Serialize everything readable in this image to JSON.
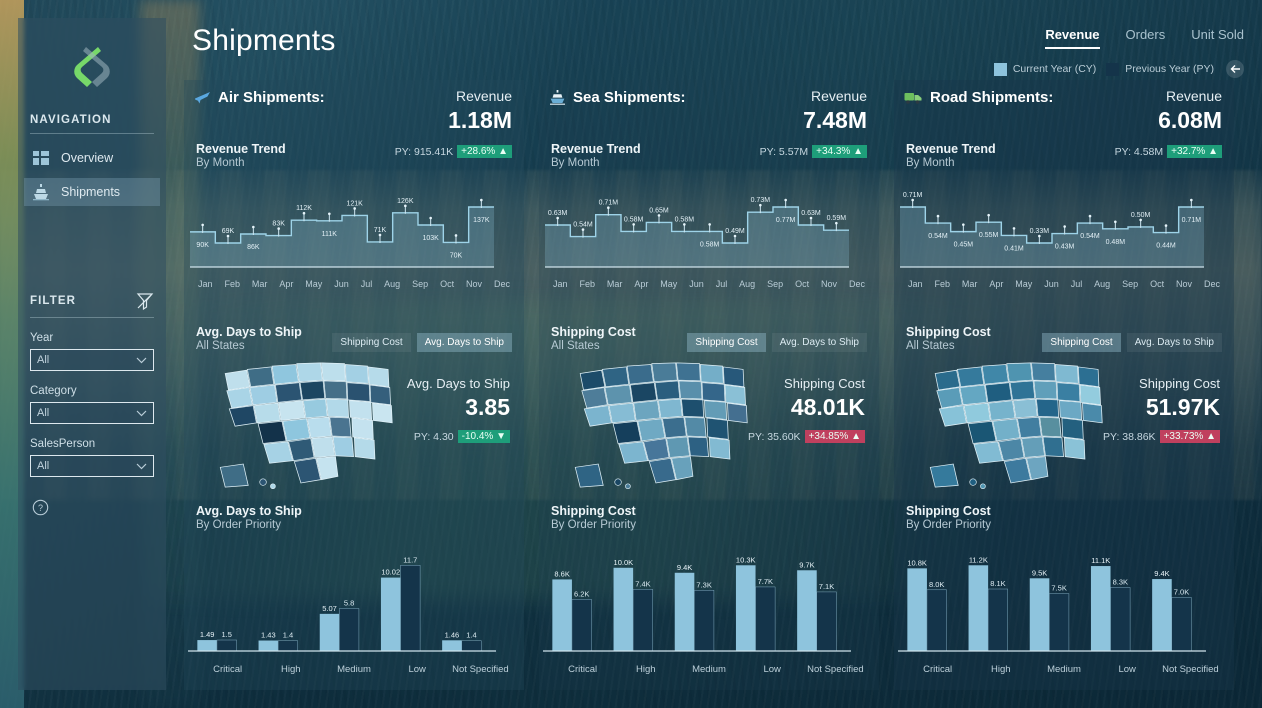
{
  "app": {
    "page_title": "Shipments",
    "logo": "s-logo-icon"
  },
  "sidebar": {
    "nav_heading": "NAVIGATION",
    "items": [
      {
        "label": "Overview",
        "icon": "dashboard-icon",
        "active": false
      },
      {
        "label": "Shipments",
        "icon": "ship-icon",
        "active": true
      }
    ],
    "filter_heading": "FILTER",
    "filter_icon": "clear-filter-icon",
    "filters": [
      {
        "label": "Year",
        "value": "All"
      },
      {
        "label": "Category",
        "value": "All"
      },
      {
        "label": "SalesPerson",
        "value": "All"
      }
    ],
    "help_icon": "question-circle-icon"
  },
  "header": {
    "tabs": [
      {
        "label": "Revenue",
        "active": true
      },
      {
        "label": "Orders",
        "active": false
      },
      {
        "label": "Unit Sold",
        "active": false
      }
    ],
    "legend": [
      {
        "label": "Current Year (CY)",
        "color": "#8ec4dd"
      },
      {
        "label": "Previous Year (PY)",
        "color": "#14344a"
      }
    ],
    "back_icon": "arrow-left-icon"
  },
  "colors": {
    "cy": "#8ec4dd",
    "py": "#14344a",
    "good": "#1e9e7a",
    "bad": "#c0405e",
    "accent_line": "#9ed3e8"
  },
  "cards": [
    {
      "id": "air",
      "icon": "airplane-icon",
      "title": "Air Shipments:",
      "kpi_label": "Revenue",
      "kpi_value": "1.18M",
      "trend": {
        "title": "Revenue Trend",
        "subtitle": "By Month",
        "py_text": "PY: 915.41K",
        "delta": "+28.6% ▲",
        "delta_kind": "up-good"
      },
      "map": {
        "title": "Avg. Days to Ship",
        "subtitle": "All States",
        "toggles": [
          {
            "label": "Shipping Cost",
            "active": false
          },
          {
            "label": "Avg. Days to Ship",
            "active": true
          }
        ],
        "kpi_label": "Avg. Days to Ship",
        "kpi_value": "3.85",
        "py_text": "PY: 4.30",
        "delta": "-10.4% ▼",
        "delta_kind": "down-good"
      },
      "bars": {
        "title": "Avg. Days to Ship",
        "subtitle": "By Order Priority"
      },
      "chart_data": {
        "trend": {
          "type": "area",
          "title": "Revenue Trend",
          "subtitle": "By Month",
          "xlabel": "",
          "ylabel": "Revenue",
          "categories": [
            "Jan",
            "Feb",
            "Mar",
            "Apr",
            "May",
            "Jun",
            "Jul",
            "Aug",
            "Sep",
            "Oct",
            "Nov",
            "Dec"
          ],
          "values": [
            90000,
            69000,
            86000,
            83000,
            112000,
            111000,
            121000,
            71000,
            126000,
            103000,
            70000,
            137000
          ],
          "labels": [
            "90K",
            "69K",
            "86K",
            "83K",
            "112K",
            "111K",
            "121K",
            "71K",
            "126K",
            "103K",
            "70K",
            "137K"
          ],
          "ylim": [
            0,
            150000
          ],
          "grid": false,
          "legend": "none"
        },
        "bars": {
          "type": "bar",
          "title": "Avg. Days to Ship",
          "subtitle": "By Order Priority",
          "categories": [
            "Critical",
            "High",
            "Medium",
            "Low",
            "Not Specified"
          ],
          "series": [
            {
              "name": "Current Year (CY)",
              "values": [
                1.49,
                1.43,
                5.07,
                10.02,
                1.46
              ],
              "labels": [
                "1.49",
                "1.43",
                "5.07",
                "10.02",
                "1.46"
              ],
              "color": "#8ec4dd"
            },
            {
              "name": "Previous Year (PY)",
              "values": [
                1.5,
                1.4,
                5.8,
                11.7,
                1.4
              ],
              "labels": [
                "1.5",
                "1.4",
                "5.8",
                "11.7",
                "1.4"
              ],
              "color": "#14344a"
            }
          ],
          "ylim": [
            0,
            13
          ],
          "grid": false
        }
      }
    },
    {
      "id": "sea",
      "icon": "ship-icon",
      "title": "Sea Shipments:",
      "kpi_label": "Revenue",
      "kpi_value": "7.48M",
      "trend": {
        "title": "Revenue Trend",
        "subtitle": "By Month",
        "py_text": "PY: 5.57M",
        "delta": "+34.3% ▲",
        "delta_kind": "up-good"
      },
      "map": {
        "title": "Shipping Cost",
        "subtitle": "All States",
        "toggles": [
          {
            "label": "Shipping Cost",
            "active": true
          },
          {
            "label": "Avg. Days to Ship",
            "active": false
          }
        ],
        "kpi_label": "Shipping Cost",
        "kpi_value": "48.01K",
        "py_text": "PY: 35.60K",
        "delta": "+34.85% ▲",
        "delta_kind": "up-bad"
      },
      "bars": {
        "title": "Shipping Cost",
        "subtitle": "By Order Priority"
      },
      "chart_data": {
        "trend": {
          "type": "area",
          "title": "Revenue Trend",
          "subtitle": "By Month",
          "categories": [
            "Jan",
            "Feb",
            "Mar",
            "Apr",
            "May",
            "Jun",
            "Jul",
            "Aug",
            "Sep",
            "Oct",
            "Nov",
            "Dec"
          ],
          "values": [
            0.63,
            0.54,
            0.71,
            0.58,
            0.65,
            0.58,
            0.58,
            0.49,
            0.73,
            0.77,
            0.63,
            0.59
          ],
          "labels": [
            "0.63M",
            "0.54M",
            "0.71M",
            "0.58M",
            "0.65M",
            "0.58M",
            "0.58M",
            "0.49M",
            "0.73M",
            "0.77M",
            "0.63M",
            "0.59M"
          ],
          "ylim": [
            0,
            0.85
          ],
          "grid": false,
          "legend": "none"
        },
        "bars": {
          "type": "bar",
          "title": "Shipping Cost",
          "subtitle": "By Order Priority",
          "categories": [
            "Critical",
            "High",
            "Medium",
            "Low",
            "Not Specified"
          ],
          "series": [
            {
              "name": "Current Year (CY)",
              "values": [
                8.6,
                10.0,
                9.4,
                10.3,
                9.7
              ],
              "labels": [
                "8.6K",
                "10.0K",
                "9.4K",
                "10.3K",
                "9.7K"
              ],
              "color": "#8ec4dd"
            },
            {
              "name": "Previous Year (PY)",
              "values": [
                6.2,
                7.4,
                7.3,
                7.7,
                7.1
              ],
              "labels": [
                "6.2K",
                "7.4K",
                "7.3K",
                "7.7K",
                "7.1K"
              ],
              "color": "#14344a"
            }
          ],
          "ylim": [
            0,
            11
          ],
          "grid": false
        }
      }
    },
    {
      "id": "road",
      "icon": "truck-icon",
      "title": "Road Shipments:",
      "kpi_label": "Revenue",
      "kpi_value": "6.08M",
      "trend": {
        "title": "Revenue Trend",
        "subtitle": "By Month",
        "py_text": "PY: 4.58M",
        "delta": "+32.7% ▲",
        "delta_kind": "up-good"
      },
      "map": {
        "title": "Shipping Cost",
        "subtitle": "All States",
        "toggles": [
          {
            "label": "Shipping Cost",
            "active": true
          },
          {
            "label": "Avg. Days to Ship",
            "active": false
          }
        ],
        "kpi_label": "Shipping Cost",
        "kpi_value": "51.97K",
        "py_text": "PY: 38.86K",
        "delta": "+33.73% ▲",
        "delta_kind": "up-bad"
      },
      "bars": {
        "title": "Shipping Cost",
        "subtitle": "By Order Priority"
      },
      "chart_data": {
        "trend": {
          "type": "area",
          "title": "Revenue Trend",
          "subtitle": "By Month",
          "categories": [
            "Jan",
            "Feb",
            "Mar",
            "Apr",
            "May",
            "Jun",
            "Jul",
            "Aug",
            "Sep",
            "Oct",
            "Nov",
            "Dec"
          ],
          "values": [
            0.71,
            0.54,
            0.45,
            0.55,
            0.41,
            0.33,
            0.43,
            0.54,
            0.48,
            0.5,
            0.44,
            0.71
          ],
          "labels": [
            "0.71M",
            "0.54M",
            "0.45M",
            "0.55M",
            "0.41M",
            "0.33M",
            "0.43M",
            "0.54M",
            "0.48M",
            "0.50M",
            "0.44M",
            "0.71M"
          ],
          "ylim": [
            0,
            0.8
          ],
          "grid": false,
          "legend": "none"
        },
        "bars": {
          "type": "bar",
          "title": "Shipping Cost",
          "subtitle": "By Order Priority",
          "categories": [
            "Critical",
            "High",
            "Medium",
            "Low",
            "Not Specified"
          ],
          "series": [
            {
              "name": "Current Year (CY)",
              "values": [
                10.8,
                11.2,
                9.5,
                11.1,
                9.4
              ],
              "labels": [
                "10.8K",
                "11.2K",
                "9.5K",
                "11.1K",
                "9.4K"
              ],
              "color": "#8ec4dd"
            },
            {
              "name": "Previous Year (PY)",
              "values": [
                8.0,
                8.1,
                7.5,
                8.3,
                7.0
              ],
              "labels": [
                "8.0K",
                "8.1K",
                "7.5K",
                "8.3K",
                "7.0K"
              ],
              "color": "#14344a"
            }
          ],
          "ylim": [
            0,
            12
          ],
          "grid": false
        }
      }
    }
  ]
}
